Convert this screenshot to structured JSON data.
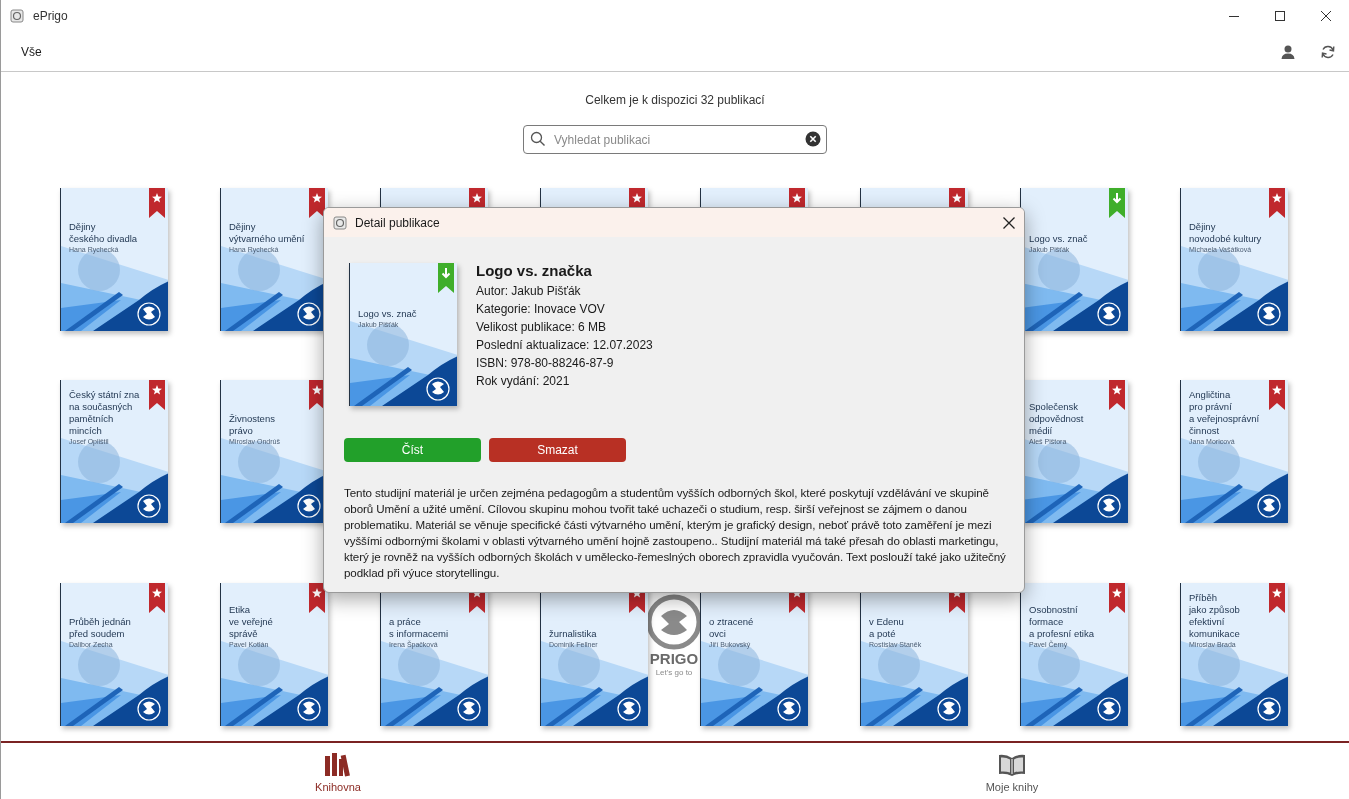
{
  "window": {
    "title": "ePrigo"
  },
  "toolbar": {
    "filter": "Vše"
  },
  "summary": "Celkem je k dispozici 32 publikací",
  "search": {
    "placeholder": "Vyhledat publikaci"
  },
  "book_rows": [
    [
      {
        "title": "Dějiny\nčeského divadla",
        "author": "Hana Rychecká",
        "downloaded": false
      },
      {
        "title": "Dějiny\nvýtvarného umění",
        "author": "Hana Rychecká",
        "downloaded": false
      },
      {
        "downloaded": false
      },
      {
        "downloaded": false
      },
      {
        "downloaded": false
      },
      {
        "downloaded": false
      },
      {
        "title": "Logo vs. znač",
        "author": "Jakub Pišťák",
        "downloaded": true
      },
      {
        "title": "Dějiny\nnovodobé kultury",
        "author": "Michaela Vašátková",
        "downloaded": false
      }
    ],
    [
      {
        "title": "Český státní zna\nna současných\npamětních mincích",
        "author": "Josef Oplištil",
        "downloaded": false
      },
      {
        "title": "Živnostens\nprávo",
        "author": "Miroslav Ondrúš",
        "downloaded": false
      },
      {
        "title": "Společensk\nodpovědnost\nmédií",
        "author": "Aleš Pištora",
        "downloaded": false
      },
      {
        "title": "Angličtina\npro právní\na veřejnosprávní\nčinnost",
        "author": "Jana Moricová",
        "downloaded": false
      }
    ],
    [
      {
        "title": "Průběh jednán\npřed soudem",
        "author": "Dalibor Zecha",
        "downloaded": false
      },
      {
        "title": "Etika\nve veřejné\nsprávě",
        "author": "Pavel Kotlán",
        "downloaded": false
      },
      {
        "title": "a práce\ns informacemi",
        "author": "Irena Špačková",
        "downloaded": false
      },
      {
        "title": "žurnalistika",
        "author": "Dominik Fellner",
        "downloaded": false
      },
      {
        "title": "o ztracené\novci",
        "author": "Jiří Bukovský",
        "downloaded": false
      },
      {
        "title": "v Edenu\na poté",
        "author": "Rostislav Staněk",
        "downloaded": false
      },
      {
        "title": "Osobnostní\nformace\na profesní etika",
        "author": "Pavel Černý",
        "downloaded": false
      },
      {
        "title": "Příběh\njako způsob\nefektivní\nkomunikace",
        "author": "Miroslav Brada",
        "downloaded": false
      }
    ]
  ],
  "splash_logo": {
    "name": "PRIGO",
    "tagline": "Let's go to"
  },
  "dialog": {
    "title": "Detail publikace",
    "book": {
      "title": "Logo vs. znač",
      "author": "Jakub Pišťák",
      "downloaded": true
    },
    "heading": "Logo vs. značka",
    "details": [
      "Autor: Jakub Pišťák",
      "Kategorie: Inovace VOV",
      "Velikost publikace: 6 MB",
      "Poslední aktualizace: 12.07.2023",
      "ISBN: 978-80-88246-87-9",
      "Rok vydání: 2021"
    ],
    "buttons": [
      {
        "label": "Číst",
        "kind": "read"
      },
      {
        "label": "Smazat",
        "kind": "delete"
      }
    ],
    "description": "Tento studijní materiál je určen zejména pedagogům a studentům vyšších odborných škol, které poskytují vzdělávání ve skupině oborů Umění a užité umění. Cílovou skupinu mohou tvořit také uchazeči o studium, resp. širší veřejnost se zájmem o danou problematiku. Materiál se věnuje specifické části výtvarného umění, kterým je grafický design, neboť právě toto zaměření je mezi vyššími odbornými školami v oblasti výtvarného umění hojně zastoupeno.. Studijní materiál má také přesah do oblasti marketingu, který je rovněž na vyšších odborných školách v umělecko-řemeslných oborech zpravidla vyučován. Text poslouží také jako užitečný podklad při výuce storytellingu."
  },
  "bottom_nav": [
    {
      "label": "Knihovna",
      "selected": true
    },
    {
      "label": "Moje knihy",
      "selected": false
    }
  ]
}
